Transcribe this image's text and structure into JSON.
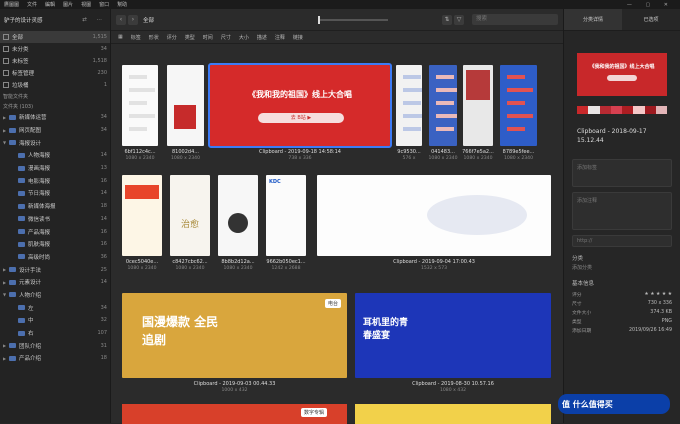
{
  "menu": [
    "鷹圖圖",
    "文件",
    "編輯",
    "圖片",
    "視圖",
    "窗口",
    "幫助"
  ],
  "sidebar": {
    "library": "驴子的设计灵感",
    "items": [
      {
        "label": "全部",
        "count": "1,515",
        "sel": true
      },
      {
        "label": "未分类",
        "count": "34"
      },
      {
        "label": "未标签",
        "count": "1,518"
      },
      {
        "label": "标签管理",
        "count": "230"
      },
      {
        "label": "垃圾桶",
        "count": "1"
      }
    ],
    "smart_title": "智能文件夹",
    "folders_title": "文件夹 (103)",
    "folders": [
      {
        "label": "新媒体运营",
        "count": "34",
        "lvl": 0,
        "arr": "▶"
      },
      {
        "label": "网页配图",
        "count": "34",
        "lvl": 0,
        "arr": "▶"
      },
      {
        "label": "海报设计",
        "count": "",
        "lvl": 0,
        "arr": "▼"
      },
      {
        "label": "人物海报",
        "count": "14",
        "lvl": 1,
        "arr": ""
      },
      {
        "label": "漫画海报",
        "count": "13",
        "lvl": 1,
        "arr": ""
      },
      {
        "label": "电影海报",
        "count": "16",
        "lvl": 1,
        "arr": ""
      },
      {
        "label": "节日海报",
        "count": "14",
        "lvl": 1,
        "arr": ""
      },
      {
        "label": "新媒体海报",
        "count": "18",
        "lvl": 1,
        "arr": ""
      },
      {
        "label": "微信读书",
        "count": "14",
        "lvl": 1,
        "arr": ""
      },
      {
        "label": "产品海报",
        "count": "16",
        "lvl": 1,
        "arr": ""
      },
      {
        "label": "肌肤海报",
        "count": "16",
        "lvl": 1,
        "arr": ""
      },
      {
        "label": "高级时尚",
        "count": "36",
        "lvl": 1,
        "arr": ""
      },
      {
        "label": "设计手法",
        "count": "25",
        "lvl": 0,
        "arr": "▶"
      },
      {
        "label": "元素设计",
        "count": "14",
        "lvl": 0,
        "arr": "▶"
      },
      {
        "label": "人物介绍",
        "count": "",
        "lvl": 0,
        "arr": "▼"
      },
      {
        "label": "左",
        "count": "34",
        "lvl": 1,
        "arr": ""
      },
      {
        "label": "中",
        "count": "32",
        "lvl": 1,
        "arr": ""
      },
      {
        "label": "右",
        "count": "107",
        "lvl": 1,
        "arr": ""
      },
      {
        "label": "团队介绍",
        "count": "31",
        "lvl": 0,
        "arr": "▶"
      },
      {
        "label": "产品介绍",
        "count": "18",
        "lvl": 0,
        "arr": "▶"
      }
    ]
  },
  "toolbar": {
    "title": "全部",
    "search_placeholder": "搜索",
    "filters": [
      "标签",
      "形状",
      "评分",
      "类型",
      "时间",
      "尺寸",
      "大小",
      "描述",
      "注释",
      "链接"
    ]
  },
  "row1": [
    {
      "name": "6bf112c4c...",
      "dim": "1080 x 2340"
    },
    {
      "name": "81002d4...",
      "dim": "1080 x 2340"
    },
    {
      "name": "Clipboard - 2019-09-18 14:58:14",
      "dim": "738 x 336",
      "banner": "《我和我的祖国》线上大合唱",
      "btn": "去 B站 ▶"
    },
    {
      "name": "9c9530...",
      "dim": "576 x"
    },
    {
      "name": "041483...",
      "dim": "1080 x 2340"
    },
    {
      "name": "766f7e5a2...",
      "dim": "1080 x 2340"
    },
    {
      "name": "8789e5fee...",
      "dim": "1080 x 2340"
    }
  ],
  "row2": [
    {
      "name": "0cec5040e...",
      "dim": "1080 x 2340"
    },
    {
      "name": "c8427cbc62...",
      "dim": "1080 x 2340",
      "word": "治愈"
    },
    {
      "name": "8b8b2d12a...",
      "dim": "1080 x 2340"
    },
    {
      "name": "9662b050ec1...",
      "dim": "1242 x 2688",
      "kdc": "KDC"
    },
    {
      "name": "Clipboard - 2019-09-04 17:00.43",
      "dim": "1532 x 573"
    }
  ],
  "row3": [
    {
      "name": "Clipboard - 2019-09-03 00.44.33",
      "dim": "1000 x 432",
      "word": "国漫爆款 全民追剧",
      "badge": "电台"
    },
    {
      "name": "Clipboard - 2019-08-30 10.57.16",
      "dim": "1080 x 432",
      "word": "耳机里的青春盛宴"
    }
  ],
  "row4": {
    "badge": "数字专辑"
  },
  "inspector": {
    "tabs": [
      "分类详情",
      "已选项"
    ],
    "preview_title": "《我和我的祖国》线上大合唱",
    "swatches": [
      "#c8282a",
      "#e8e4e4",
      "#b82a32",
      "#d64050",
      "#ad1d22",
      "#f5c8c8",
      "#9e1a20",
      "#e3b5b8"
    ],
    "name": "Clipboard - 2018-09-17 15.12.44",
    "tags_placeholder": "添加标签",
    "notes_placeholder": "添加注释",
    "url_placeholder": "http://",
    "category_title": "分类",
    "add_category": "添加分类",
    "info_title": "基本信息",
    "info": [
      {
        "k": "评分",
        "v": "★ ★ ★ ★ ★"
      },
      {
        "k": "尺寸",
        "v": "730 x 336"
      },
      {
        "k": "文件大小",
        "v": "374.3 KB"
      },
      {
        "k": "类型",
        "v": "PNG"
      },
      {
        "k": "添加日期",
        "v": "2019/09/26 16:49"
      }
    ]
  },
  "watermark": "值 什么值得买"
}
